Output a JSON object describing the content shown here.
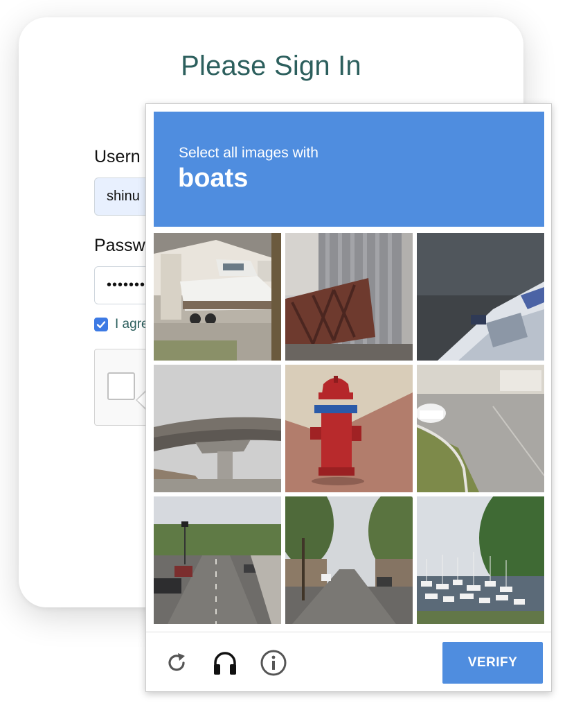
{
  "form": {
    "title": "Please Sign In",
    "username_label": "Usern",
    "username_value": "shinu",
    "password_label": "Passw",
    "password_value": "•••••••",
    "agree_text": "I agre",
    "agree_checked": true
  },
  "challenge": {
    "instruction": "Select all images with",
    "target": "boats",
    "tiles": [
      {
        "content": "boat on trailer in driveway"
      },
      {
        "content": "steel bridge structure by building"
      },
      {
        "content": "boat bow on water"
      },
      {
        "content": "highway overpass"
      },
      {
        "content": "red fire hydrant"
      },
      {
        "content": "parking lot with car"
      },
      {
        "content": "city street with cars"
      },
      {
        "content": "tree-lined street"
      },
      {
        "content": "marina with boats"
      }
    ],
    "footer": {
      "reload_icon": "reload-icon",
      "audio_icon": "headphones-icon",
      "info_icon": "info-icon",
      "verify_label": "VERIFY"
    }
  },
  "colors": {
    "header_blue": "#4f8ddf",
    "title_teal": "#2c5f5d",
    "checkbox_blue": "#3d7ae4"
  }
}
